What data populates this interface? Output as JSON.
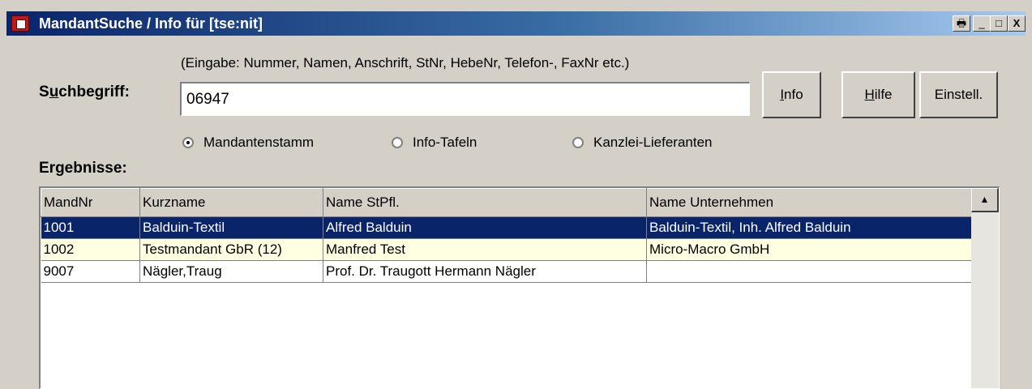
{
  "window": {
    "title": "MandantSuche / Info für [tse:nit]",
    "controls": {
      "print": "🖶",
      "minimize": "_",
      "maximize": "□",
      "close": "X"
    }
  },
  "search": {
    "hint": "(Eingabe: Nummer, Namen, Anschrift, StNr, HebeNr, Telefon-, FaxNr etc.)",
    "label": "Suchbegriff:",
    "value": "06947"
  },
  "buttons": {
    "info": "Info",
    "help": "Hilfe",
    "settings": "Einstell."
  },
  "radios": [
    {
      "label": "Mandantenstamm",
      "checked": true
    },
    {
      "label": "Info-Tafeln",
      "checked": false
    },
    {
      "label": "Kanzlei-Lieferanten",
      "checked": false
    }
  ],
  "results": {
    "label": "Ergebnisse:",
    "columns": [
      "MandNr",
      "Kurzname",
      "Name StPfl.",
      "Name Unternehmen"
    ],
    "rows": [
      {
        "mandnr": "1001",
        "kurzname": "Balduin-Textil",
        "name_stpfl": "Alfred Balduin",
        "name_unternehmen": "Balduin-Textil, Inh. Alfred Balduin",
        "state": "selected"
      },
      {
        "mandnr": "1002",
        "kurzname": "Testmandant GbR (12)",
        "name_stpfl": "Manfred Test",
        "name_unternehmen": "Micro-Macro GmbH",
        "state": "highlight"
      },
      {
        "mandnr": "9007",
        "kurzname": "Nägler,Traug",
        "name_stpfl": "Prof. Dr. Traugott Hermann Nägler",
        "name_unternehmen": "",
        "state": "plain"
      }
    ]
  },
  "scrollbar": {
    "up_icon": "▲"
  },
  "colors": {
    "title_start": "#0a246a",
    "title_end": "#a6caf0",
    "selected_row": "#0a246a",
    "highlight_row": "#ffffe1",
    "face": "#d4d0c8"
  }
}
